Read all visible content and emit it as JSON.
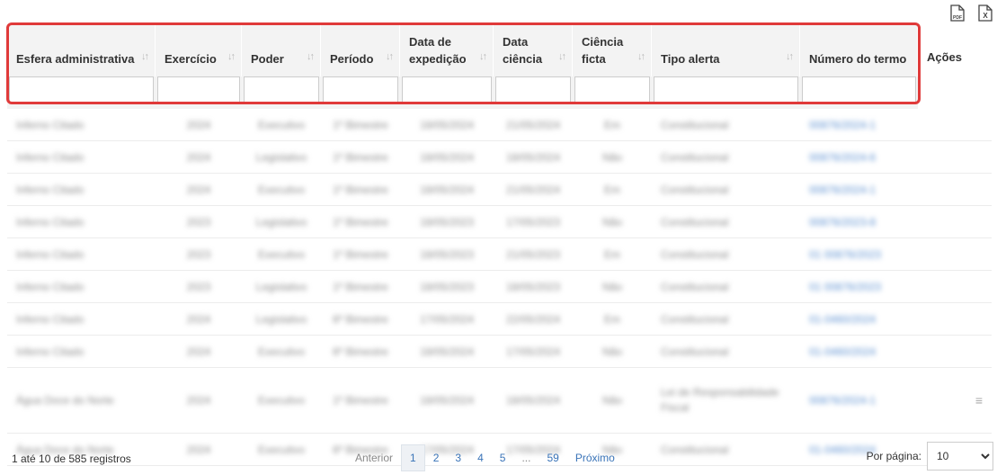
{
  "exports": {
    "pdf_label": "PDF",
    "xls_label": "X"
  },
  "table": {
    "headers": [
      {
        "label": "Esfera administrativa",
        "sortable": true
      },
      {
        "label": "Exercício",
        "sortable": true
      },
      {
        "label": "Poder",
        "sortable": true
      },
      {
        "label": "Período",
        "sortable": true
      },
      {
        "label": "Data de expedição",
        "sortable": true
      },
      {
        "label": "Data ciência",
        "sortable": true
      },
      {
        "label": "Ciência ficta",
        "sortable": true
      },
      {
        "label": "Tipo alerta",
        "sortable": true
      },
      {
        "label": "Número do termo",
        "sortable": false
      },
      {
        "label": "Ações",
        "sortable": false
      }
    ],
    "sort_glyph": "↓↑",
    "rows": [
      [
        "Inferno Citado",
        "2024",
        "Executivo",
        "1º Bimestre",
        "18/05/2024",
        "21/05/2024",
        "Em",
        "Constitucional",
        "00876/2024-1",
        ""
      ],
      [
        "Inferno Citado",
        "2024",
        "Legislativo",
        "1º Bimestre",
        "18/05/2024",
        "18/05/2024",
        "Não",
        "Constitucional",
        "00876/2024-6",
        ""
      ],
      [
        "Inferno Citado",
        "2024",
        "Executivo",
        "1º Bimestre",
        "18/05/2024",
        "21/05/2024",
        "Em",
        "Constitucional",
        "00876/2024-1",
        ""
      ],
      [
        "Inferno Citado",
        "2023",
        "Legislativo",
        "1º Bimestre",
        "18/05/2023",
        "17/05/2023",
        "Não",
        "Constitucional",
        "00876/2023-8",
        ""
      ],
      [
        "Inferno Citado",
        "2023",
        "Executivo",
        "1º Bimestre",
        "18/05/2023",
        "21/05/2023",
        "Em",
        "Constitucional",
        "01 00876/2023",
        ""
      ],
      [
        "Inferno Citado",
        "2023",
        "Legislativo",
        "1º Bimestre",
        "18/05/2023",
        "18/05/2023",
        "Não",
        "Constitucional",
        "01 00876/2023",
        ""
      ],
      [
        "Inferno Citado",
        "2024",
        "Legislativo",
        "6º Bimestre",
        "17/05/2024",
        "22/05/2024",
        "Em",
        "Constitucional",
        "01-0460/2024",
        ""
      ],
      [
        "Inferno Citado",
        "2024",
        "Executivo",
        "6º Bimestre",
        "18/05/2024",
        "17/05/2024",
        "Não",
        "Constitucional",
        "01-0460/2024",
        ""
      ],
      [
        "Água Doce do Norte",
        "2024",
        "Executivo",
        "1º Bimestre",
        "18/05/2024",
        "18/05/2024",
        "Não",
        "Lei de Responsabilidade Fiscal",
        "00876/2024-1",
        "≡"
      ],
      [
        "Água Doce do Norte",
        "2024",
        "Executivo",
        "6º Bimestre",
        "17/05/2024",
        "17/05/2024",
        "Não",
        "Constitucional",
        "01-0460/2024",
        ""
      ]
    ]
  },
  "footer": {
    "info": "1 até 10 de 585 registros",
    "prev": "Anterior",
    "pages": [
      "1",
      "2",
      "3",
      "4",
      "5",
      "...",
      "59"
    ],
    "next": "Próximo",
    "per_page_label": "Por página:",
    "per_page_value": "10"
  },
  "colors": {
    "highlight": "#e03a3a",
    "header_bg": "#f3f3f3",
    "link": "#3a74b8"
  }
}
